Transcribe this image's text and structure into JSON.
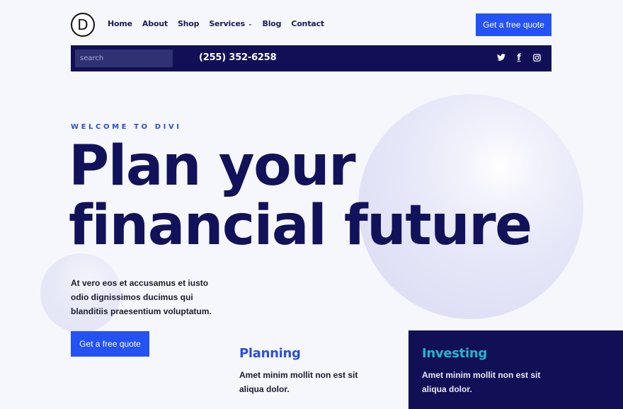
{
  "header": {
    "logo_letter": "D",
    "nav": [
      {
        "label": "Home"
      },
      {
        "label": "About"
      },
      {
        "label": "Shop"
      },
      {
        "label": "Services",
        "has_dropdown": true,
        "dropdown_icon": "chevron-down-icon"
      },
      {
        "label": "Blog"
      },
      {
        "label": "Contact"
      }
    ],
    "cta_label": "Get a free quote"
  },
  "topbar": {
    "search_placeholder": "search",
    "search_value": "",
    "phone": "(255) 352-6258",
    "social": [
      {
        "name": "twitter",
        "icon": "twitter-icon"
      },
      {
        "name": "facebook",
        "icon": "facebook-icon",
        "glyph": "f"
      },
      {
        "name": "instagram",
        "icon": "instagram-icon"
      }
    ]
  },
  "hero": {
    "eyebrow": "WELCOME TO DIVI",
    "headline_line1": "Plan your",
    "headline_line2": "financial future",
    "body": "At vero eos et accusamus et iusto odio dignissimos ducimus qui blanditiis praesentium voluptatum.",
    "cta_label": "Get a free quote"
  },
  "cards": [
    {
      "title": "Planning",
      "text": "Amet minim mollit non est sit aliqua dolor."
    },
    {
      "title": "Investing",
      "text": "Amet minim mollit non est sit aliqua dolor."
    }
  ],
  "colors": {
    "primary_blue": "#2552f5",
    "navy": "#110f56",
    "heading_navy": "#12125a",
    "accent_blue": "#2c4fd6",
    "teal": "#20b8c8",
    "background": "#f6f7fd"
  }
}
